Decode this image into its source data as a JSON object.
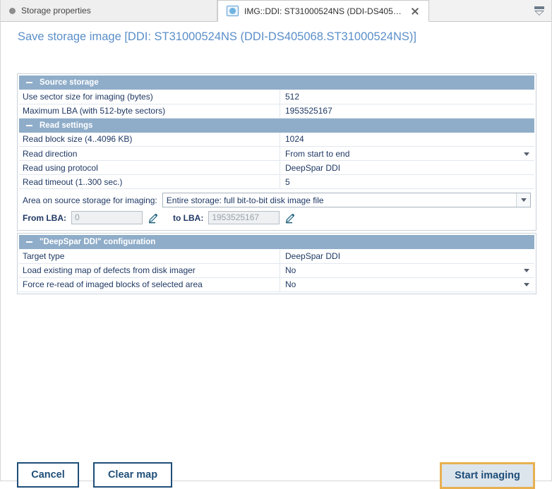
{
  "tabs": [
    {
      "label": "Storage properties",
      "icon": "dot-icon",
      "active": false,
      "closable": false
    },
    {
      "label": "IMG::DDI: ST31000524NS (DDI-DS405068.ST3...",
      "icon": "disk-icon",
      "active": true,
      "closable": true
    }
  ],
  "tab_menu_icon": "tab-list-dropdown-icon",
  "page_title": "Save storage image [DDI: ST31000524NS (DDI-DS405068.ST31000524NS)]",
  "sections": [
    {
      "title": "Source storage",
      "rows": [
        {
          "label": "Use sector size for imaging (bytes)",
          "value": "512",
          "dropdown": false
        },
        {
          "label": "Maximum LBA (with 512-byte sectors)",
          "value": "1953525167",
          "dropdown": false
        }
      ]
    },
    {
      "title": "Read settings",
      "rows": [
        {
          "label": "Read block size (4..4096 KB)",
          "value": "1024",
          "dropdown": false
        },
        {
          "label": "Read direction",
          "value": "From start to end",
          "dropdown": true
        },
        {
          "label": "Read using protocol",
          "value": "DeepSpar DDI",
          "dropdown": false
        },
        {
          "label": "Read timeout (1..300 sec.)",
          "value": "5",
          "dropdown": false
        }
      ]
    }
  ],
  "area": {
    "caption": "Area on source storage for imaging:",
    "selected": "Entire storage: full bit-to-bit disk image file",
    "dropdown_icon": "chevron-down-icon",
    "from_label": "From LBA:",
    "from_value": "0",
    "to_label": "to LBA:",
    "to_value": "1953525167",
    "edit_icon": "pencil-icon"
  },
  "ddi_section": {
    "title": "\"DeepSpar DDI\" configuration",
    "rows": [
      {
        "label": "Target type",
        "value": "DeepSpar DDI",
        "dropdown": false
      },
      {
        "label": "Load existing map of defects from disk imager",
        "value": "No",
        "dropdown": true
      },
      {
        "label": "Force re-read of imaged blocks of selected area",
        "value": "No",
        "dropdown": true
      }
    ]
  },
  "buttons": {
    "cancel": "Cancel",
    "clear_map": "Clear map",
    "start_imaging": "Start imaging"
  },
  "colors": {
    "title_blue": "#5b8fc9",
    "section_header_bg": "#8fadc9",
    "text_blue": "#1f3864",
    "button_border": "#1f4e79",
    "highlight_orange": "#e8b051",
    "start_button_bg": "#dde5ec"
  }
}
